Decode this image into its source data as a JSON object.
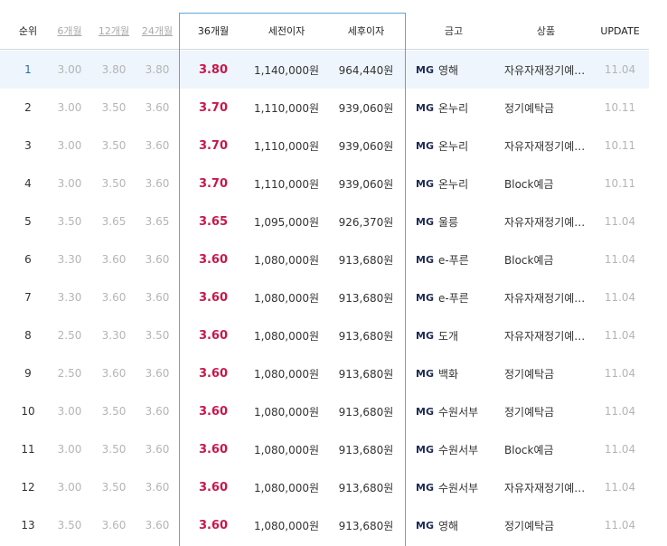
{
  "table": {
    "headers": {
      "rank": "순위",
      "m6": "6개월",
      "m12": "12개월",
      "m24": "24개월",
      "m36": "36개월",
      "pretax": "세전이자",
      "posttax": "세후이자",
      "bank": "금고",
      "product": "상품",
      "update": "UPDATE"
    },
    "bank_prefix": "MG",
    "rows": [
      {
        "rank": "1",
        "m6": "3.00",
        "m12": "3.80",
        "m24": "3.80",
        "m36": "3.80",
        "pretax": "1,140,000원",
        "posttax": "964,440원",
        "bank": "영해",
        "product": "자유자재정기예…",
        "update": "11.04"
      },
      {
        "rank": "2",
        "m6": "3.00",
        "m12": "3.50",
        "m24": "3.60",
        "m36": "3.70",
        "pretax": "1,110,000원",
        "posttax": "939,060원",
        "bank": "온누리",
        "product": "정기예탁금",
        "update": "10.11"
      },
      {
        "rank": "3",
        "m6": "3.00",
        "m12": "3.50",
        "m24": "3.60",
        "m36": "3.70",
        "pretax": "1,110,000원",
        "posttax": "939,060원",
        "bank": "온누리",
        "product": "자유자재정기예…",
        "update": "10.11"
      },
      {
        "rank": "4",
        "m6": "3.00",
        "m12": "3.50",
        "m24": "3.60",
        "m36": "3.70",
        "pretax": "1,110,000원",
        "posttax": "939,060원",
        "bank": "온누리",
        "product": "Block예금",
        "update": "10.11"
      },
      {
        "rank": "5",
        "m6": "3.50",
        "m12": "3.65",
        "m24": "3.65",
        "m36": "3.65",
        "pretax": "1,095,000원",
        "posttax": "926,370원",
        "bank": "울릉",
        "product": "자유자재정기예…",
        "update": "11.04"
      },
      {
        "rank": "6",
        "m6": "3.30",
        "m12": "3.60",
        "m24": "3.60",
        "m36": "3.60",
        "pretax": "1,080,000원",
        "posttax": "913,680원",
        "bank": "e-푸른",
        "product": "Block예금",
        "update": "11.04"
      },
      {
        "rank": "7",
        "m6": "3.30",
        "m12": "3.60",
        "m24": "3.60",
        "m36": "3.60",
        "pretax": "1,080,000원",
        "posttax": "913,680원",
        "bank": "e-푸른",
        "product": "자유자재정기예…",
        "update": "11.04"
      },
      {
        "rank": "8",
        "m6": "2.50",
        "m12": "3.30",
        "m24": "3.50",
        "m36": "3.60",
        "pretax": "1,080,000원",
        "posttax": "913,680원",
        "bank": "도개",
        "product": "자유자재정기예…",
        "update": "11.04"
      },
      {
        "rank": "9",
        "m6": "2.50",
        "m12": "3.60",
        "m24": "3.60",
        "m36": "3.60",
        "pretax": "1,080,000원",
        "posttax": "913,680원",
        "bank": "백화",
        "product": "정기예탁금",
        "update": "11.04"
      },
      {
        "rank": "10",
        "m6": "3.00",
        "m12": "3.50",
        "m24": "3.60",
        "m36": "3.60",
        "pretax": "1,080,000원",
        "posttax": "913,680원",
        "bank": "수원서부",
        "product": "정기예탁금",
        "update": "11.04"
      },
      {
        "rank": "11",
        "m6": "3.00",
        "m12": "3.50",
        "m24": "3.60",
        "m36": "3.60",
        "pretax": "1,080,000원",
        "posttax": "913,680원",
        "bank": "수원서부",
        "product": "Block예금",
        "update": "11.04"
      },
      {
        "rank": "12",
        "m6": "3.00",
        "m12": "3.50",
        "m24": "3.60",
        "m36": "3.60",
        "pretax": "1,080,000원",
        "posttax": "913,680원",
        "bank": "수원서부",
        "product": "자유자재정기예…",
        "update": "11.04"
      },
      {
        "rank": "13",
        "m6": "3.50",
        "m12": "3.60",
        "m24": "3.60",
        "m36": "3.60",
        "pretax": "1,080,000원",
        "posttax": "913,680원",
        "bank": "영해",
        "product": "정기예탁금",
        "update": "11.04"
      }
    ]
  },
  "colors": {
    "accent_rate": "#c8184b",
    "highlight_row": "#eef5fc",
    "selected_column_border": "#5aa6dc",
    "bank_badge": "#1d2a52"
  }
}
